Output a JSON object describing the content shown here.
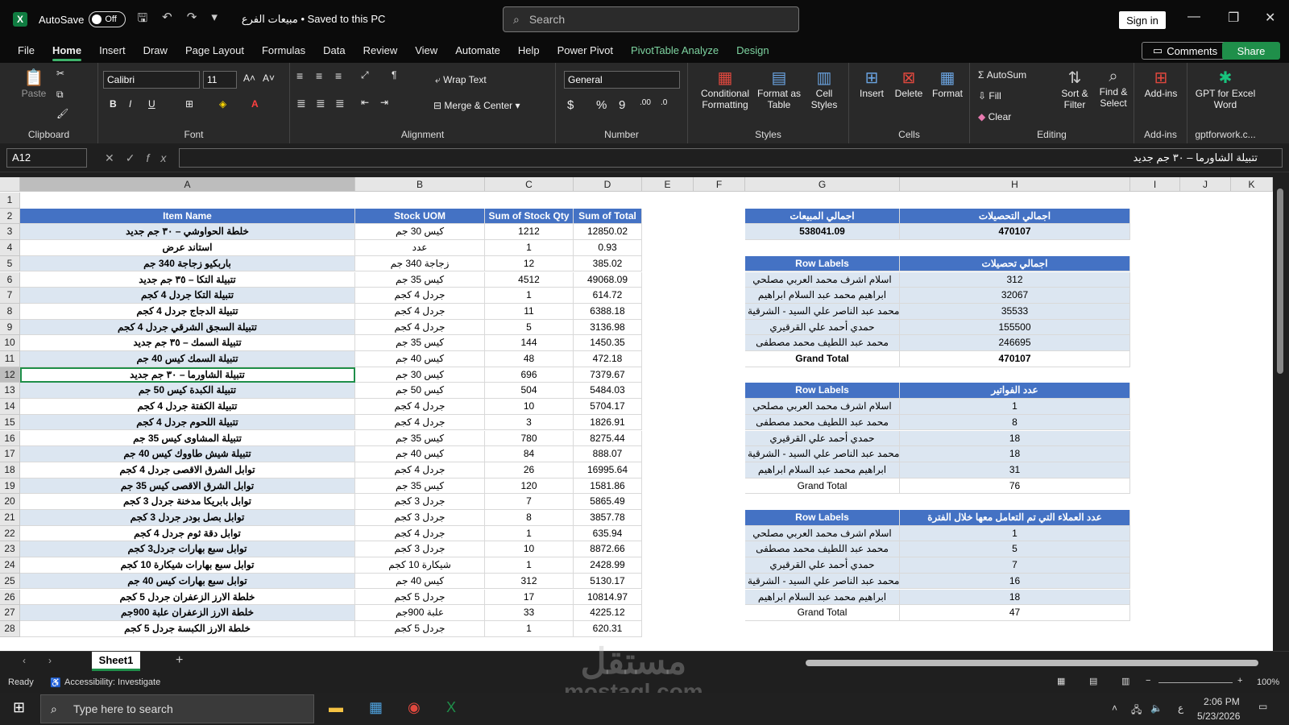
{
  "titlebar": {
    "autosave_label": "AutoSave",
    "autosave_state": "Off",
    "doc_name": "مبيعات الفرع • Saved to this PC",
    "search_placeholder": "Search",
    "sign_in": "Sign in"
  },
  "menu": [
    "File",
    "Home",
    "Insert",
    "Draw",
    "Page Layout",
    "Formulas",
    "Data",
    "Review",
    "View",
    "Automate",
    "Help",
    "Power Pivot",
    "PivotTable Analyze",
    "Design"
  ],
  "buttons": {
    "comments": "Comments",
    "share": "Share"
  },
  "ribbon": {
    "clipboard": {
      "paste": "Paste",
      "label": "Clipboard"
    },
    "font": {
      "name": "Calibri",
      "size": "11",
      "label": "Font"
    },
    "alignment": {
      "wrap": "Wrap Text",
      "merge": "Merge & Center",
      "label": "Alignment"
    },
    "number": {
      "format": "General",
      "label": "Number"
    },
    "styles": {
      "cond": "Conditional Formatting",
      "table": "Format as Table",
      "cell": "Cell Styles",
      "label": "Styles"
    },
    "cells": {
      "insert": "Insert",
      "delete": "Delete",
      "format": "Format",
      "label": "Cells"
    },
    "editing": {
      "autosum": "AutoSum",
      "fill": "Fill",
      "clear": "Clear",
      "sort": "Sort & Filter",
      "find": "Find & Select",
      "label": "Editing"
    },
    "addins": {
      "addins": "Add-ins",
      "label": "Add-ins"
    },
    "gpt": {
      "name": "GPT for Excel Word",
      "label": "gptforwork.c..."
    }
  },
  "formula_bar": {
    "cell_ref": "A12",
    "content": "تتبيلة الشاورما – ٣٠ جم جديد"
  },
  "columns": [
    "A",
    "B",
    "C",
    "D",
    "E",
    "F",
    "G",
    "H",
    "I",
    "J",
    "K"
  ],
  "rows": [
    "1",
    "2",
    "3",
    "4",
    "5",
    "6",
    "7",
    "8",
    "9",
    "10",
    "11",
    "12",
    "13",
    "14",
    "15",
    "16",
    "17",
    "18",
    "19",
    "20",
    "21",
    "22",
    "23",
    "24",
    "25",
    "26",
    "27",
    "28"
  ],
  "table_main": {
    "headers": [
      "Item Name",
      "Stock UOM",
      "Sum of Stock Qty",
      "Sum of Total"
    ],
    "rows": [
      [
        "خلطة الحواوشي – ٣٠ جم جديد",
        "كيس 30 جم",
        "1212",
        "12850.02"
      ],
      [
        "استاند عرض",
        "عدد",
        "1",
        "0.93"
      ],
      [
        "باربكيو زجاجة 340 جم",
        "زجاجة 340 جم",
        "12",
        "385.02"
      ],
      [
        "تتبيلة التكا – ٣٥ جم جديد",
        "كيس 35 جم",
        "4512",
        "49068.09"
      ],
      [
        "تتبيلة التكا جردل 4 كجم",
        "جردل 4 كجم",
        "1",
        "614.72"
      ],
      [
        "تتبيلة الدجاج جردل 4 كجم",
        "جردل 4 كجم",
        "11",
        "6388.18"
      ],
      [
        "تتبيلة السجق الشرقي جردل 4 كجم",
        "جردل 4 كجم",
        "5",
        "3136.98"
      ],
      [
        "تتبيلة السمك – ٣٥ جم جديد",
        "كيس 35 جم",
        "144",
        "1450.35"
      ],
      [
        "تتبيلة السمك كيس 40 جم",
        "كيس 40 جم",
        "48",
        "472.18"
      ],
      [
        "تتبيلة الشاورما – ٣٠ جم جديد",
        "كيس 30 جم",
        "696",
        "7379.67"
      ],
      [
        "تتبيلة الكبدة كيس 50 جم",
        "كيس 50 جم",
        "504",
        "5484.03"
      ],
      [
        "تتبيلة الكفتة جردل 4 كجم",
        "جردل 4 كجم",
        "10",
        "5704.17"
      ],
      [
        "تتبيلة اللحوم جردل 4 كجم",
        "جردل 4 كجم",
        "3",
        "1826.91"
      ],
      [
        "تتبيلة المشاوى كيس 35 جم",
        "كيس 35 جم",
        "780",
        "8275.44"
      ],
      [
        "تتبيلة شيش طاووك كيس 40 جم",
        "كيس 40 جم",
        "84",
        "888.07"
      ],
      [
        "توابل الشرق الاقصى جردل 4 كجم",
        "جردل 4 كجم",
        "26",
        "16995.64"
      ],
      [
        "توابل الشرق الاقصى كيس 35 جم",
        "كيس 35 جم",
        "120",
        "1581.86"
      ],
      [
        "توابل بابريكا مدخنة جردل 3 كجم",
        "جردل 3 كجم",
        "7",
        "5865.49"
      ],
      [
        "توابل بصل بودر جردل 3 كجم",
        "جردل 3 كجم",
        "8",
        "3857.78"
      ],
      [
        "توابل دقة ثوم جردل 4 كجم",
        "جردل 4 كجم",
        "1",
        "635.94"
      ],
      [
        "توابل سبع بهارات جردل3 كجم",
        "جردل 3 كجم",
        "10",
        "8872.66"
      ],
      [
        "توابل سبع بهارات شيكارة 10 كجم",
        "شيكارة 10 كجم",
        "1",
        "2428.99"
      ],
      [
        "توابل سبع بهارات كيس 40 جم",
        "كيس 40 جم",
        "312",
        "5130.17"
      ],
      [
        "خلطة الارز الزعفران جردل 5 كجم",
        "جردل 5 كجم",
        "17",
        "10814.97"
      ],
      [
        "خلطة الارز الزعفران علبة 900جم",
        "علبة 900جم",
        "33",
        "4225.12"
      ],
      [
        "خلطة الارز الكبسة جردل 5 كجم",
        "جردل 5 كجم",
        "1",
        "620.31"
      ]
    ]
  },
  "summary": {
    "h_sales": "اجمالي المبيعات",
    "h_collect": "اجمالي التحصيلات",
    "sales": "538041.09",
    "collect": "470107"
  },
  "pivot1": {
    "h_labels": "Row Labels",
    "h_value": "اجمالي تحصيلات",
    "rows": [
      [
        "اسلام اشرف محمد العربي مصلحي",
        "312"
      ],
      [
        "ابراهيم محمد عبد السلام ابراهيم",
        "32067"
      ],
      [
        "محمد عبد الناصر علي السيد - الشرقية",
        "35533"
      ],
      [
        "حمدي أحمد علي القرقيري",
        "155500"
      ],
      [
        "محمد عبد اللطيف محمد مصطفى",
        "246695"
      ]
    ],
    "total_label": "Grand Total",
    "total": "470107"
  },
  "pivot2": {
    "h_labels": "Row Labels",
    "h_value": "عدد الفواتير",
    "rows": [
      [
        "اسلام اشرف محمد العربي مصلحي",
        "1"
      ],
      [
        "محمد عبد اللطيف محمد مصطفى",
        "8"
      ],
      [
        "حمدي أحمد علي القرقيري",
        "18"
      ],
      [
        "محمد عبد الناصر علي السيد - الشرقية",
        "18"
      ],
      [
        "ابراهيم محمد عبد السلام ابراهيم",
        "31"
      ]
    ],
    "total_label": "Grand Total",
    "total": "76"
  },
  "pivot3": {
    "h_labels": "Row Labels",
    "h_value": "عدد العملاء التي تم التعامل معها خلال الفترة",
    "rows": [
      [
        "اسلام اشرف محمد العربي مصلحي",
        "1"
      ],
      [
        "محمد عبد اللطيف محمد مصطفى",
        "5"
      ],
      [
        "حمدي أحمد علي القرقيري",
        "7"
      ],
      [
        "محمد عبد الناصر علي السيد - الشرقية",
        "16"
      ],
      [
        "ابراهيم محمد عبد السلام ابراهيم",
        "18"
      ]
    ],
    "total_label": "Grand Total",
    "total": "47"
  },
  "sheet_tab": "Sheet1",
  "status": {
    "ready": "Ready",
    "accessibility": "Accessibility: Investigate",
    "zoom": "100%"
  },
  "taskbar": {
    "search": "Type here to search",
    "time": "2:06 PM",
    "date": "5/23/2026",
    "lang": "ع"
  },
  "watermark": {
    "ar": "مستقل",
    "en": "mostaql.com"
  }
}
